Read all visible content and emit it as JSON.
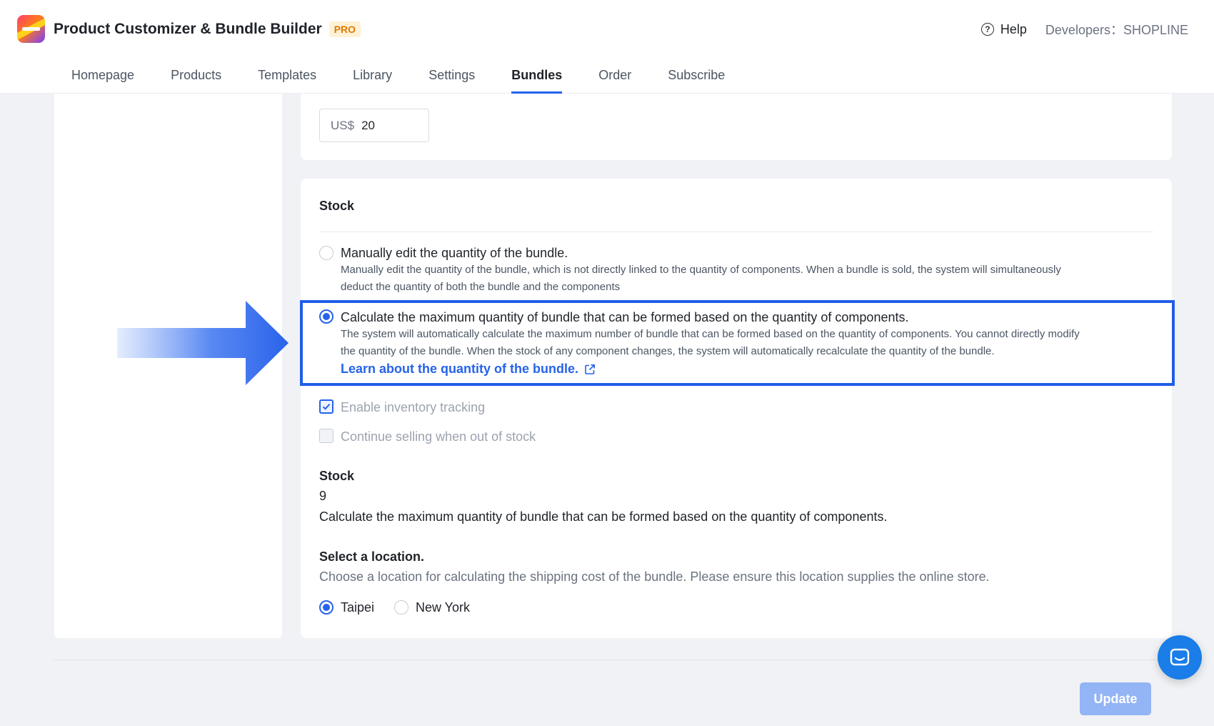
{
  "app": {
    "title": "Product Customizer & Bundle Builder",
    "badge": "PRO",
    "help_label": "Help",
    "developers_label": "Developers：SHOPLINE"
  },
  "nav": {
    "items": [
      "Homepage",
      "Products",
      "Templates",
      "Library",
      "Settings",
      "Bundles",
      "Order",
      "Subscribe"
    ],
    "active": "Bundles"
  },
  "price": {
    "prefix": "US$",
    "value": "20"
  },
  "stock_section": {
    "title": "Stock",
    "options": [
      {
        "title": "Manually edit the quantity of the bundle.",
        "desc_line1": "Manually edit the quantity of the bundle, which is not directly linked to the quantity of components. When a bundle is sold, the system will simultaneously",
        "desc_line2": "deduct the quantity of both the bundle and the components",
        "selected": false
      },
      {
        "title": "Calculate the maximum quantity of bundle that can be formed based on the quantity of components.",
        "desc_line1": "The system will automatically calculate the maximum number of bundle that can be formed based on the quantity of components. You cannot directly modify",
        "desc_line2": "the quantity of the bundle. When the stock of any component changes, the system will automatically recalculate the quantity of the bundle.",
        "link": "Learn about the quantity of the bundle.",
        "selected": true
      }
    ],
    "checkboxes": [
      {
        "label": "Enable inventory tracking",
        "checked": true,
        "disabled": true
      },
      {
        "label": "Continue selling when out of stock",
        "checked": false,
        "disabled": true
      }
    ],
    "stock_label": "Stock",
    "stock_value": "9",
    "stock_note": "Calculate the maximum quantity of bundle that can be formed based on the quantity of components.",
    "location_title": "Select a location.",
    "location_desc": "Choose a location for calculating the shipping cost of the bundle. Please ensure this location supplies the online store.",
    "locations": [
      {
        "label": "Taipei",
        "selected": true
      },
      {
        "label": "New York",
        "selected": false
      }
    ]
  },
  "footer": {
    "update_label": "Update"
  },
  "colors": {
    "accent": "#2563eb",
    "highlight_border": "#1f5ee8",
    "update_disabled": "#93b4f5",
    "chat": "#1a7de8"
  },
  "icons": {
    "help": "question-circle-icon",
    "external_link": "external-link-icon",
    "chat": "chat-icon",
    "arrow": "right-arrow-icon"
  }
}
